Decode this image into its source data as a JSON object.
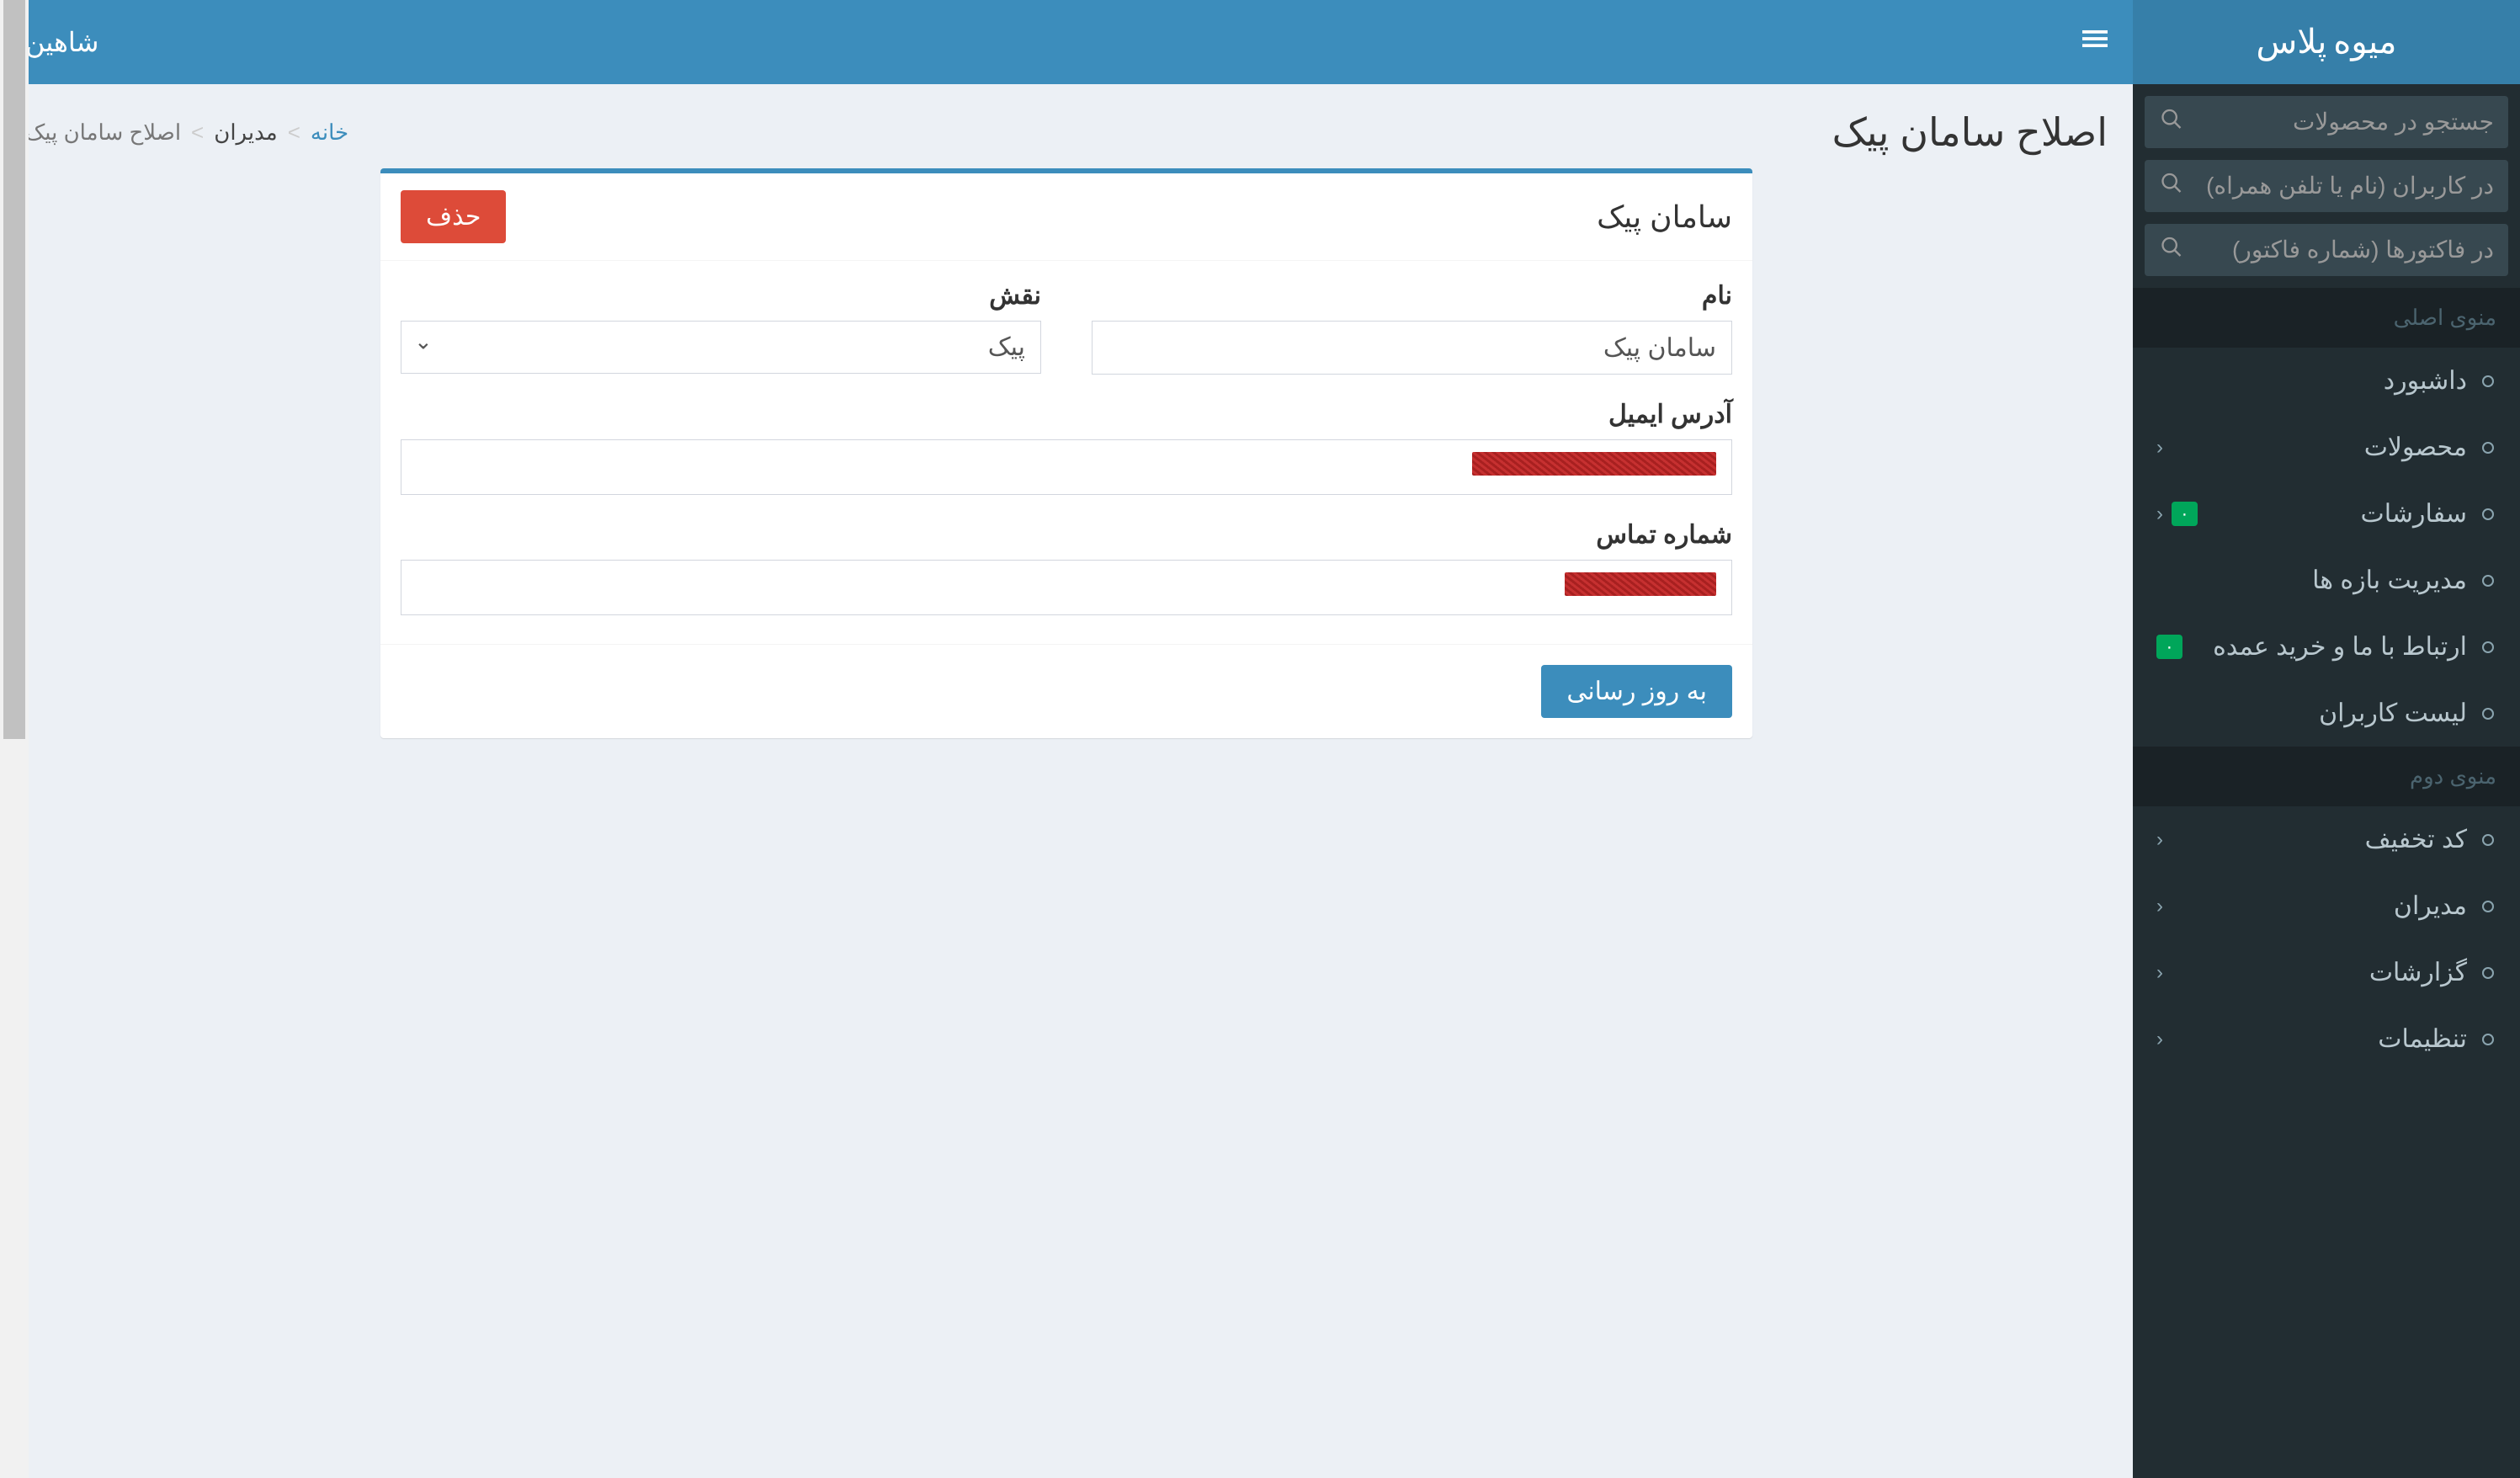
{
  "brand": {
    "bold": "میوه",
    "light": "پلاس"
  },
  "topbar": {
    "user": "شاهین"
  },
  "sidebar": {
    "search_products": "جستجو در محصولات",
    "search_users": "در کاربران (نام یا تلفن همراه)",
    "search_invoices": "در فاکتورها (شماره فاکتور)",
    "header1": "منوی اصلی",
    "header2": "منوی دوم",
    "menu1": [
      {
        "label": "داشبورد",
        "chevron": false,
        "badge": null
      },
      {
        "label": "محصولات",
        "chevron": true,
        "badge": null
      },
      {
        "label": "سفارشات",
        "chevron": true,
        "badge": "۰"
      },
      {
        "label": "مدیریت بازه ها",
        "chevron": false,
        "badge": null
      },
      {
        "label": "ارتباط با ما و خرید عمده",
        "chevron": false,
        "badge": "۰"
      },
      {
        "label": "لیست کاربران",
        "chevron": false,
        "badge": null
      }
    ],
    "menu2": [
      {
        "label": "کد تخفیف",
        "chevron": true
      },
      {
        "label": "مدیران",
        "chevron": true
      },
      {
        "label": "گزارشات",
        "chevron": true
      },
      {
        "label": "تنظیمات",
        "chevron": true
      }
    ]
  },
  "page": {
    "title": "اصلاح سامان پیک",
    "breadcrumb": {
      "home": "خانه",
      "managers": "مدیران",
      "current": "اصلاح سامان پیک"
    }
  },
  "box": {
    "title": "سامان پیک",
    "delete": "حذف",
    "update": "به روز رسانی",
    "labels": {
      "name": "نام",
      "role": "نقش",
      "email": "آدرس ایمیل",
      "phone": "شماره تماس"
    },
    "values": {
      "name": "سامان پیک",
      "role": "پیک",
      "email": "",
      "phone": ""
    },
    "role_options": [
      "پیک"
    ]
  }
}
